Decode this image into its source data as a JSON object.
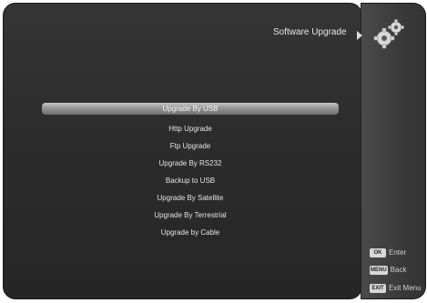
{
  "header": {
    "title": "Software Upgrade",
    "icon": "gear-icon"
  },
  "menu": {
    "items": [
      {
        "label": "Upgrade By USB",
        "selected": true
      },
      {
        "label": "Http Upgrade",
        "selected": false
      },
      {
        "label": "Ftp Upgrade",
        "selected": false
      },
      {
        "label": "Upgrade By RS232",
        "selected": false
      },
      {
        "label": "Backup to USB",
        "selected": false
      },
      {
        "label": "Upgrade By Satellite",
        "selected": false
      },
      {
        "label": "Upgrade By Terrestrial",
        "selected": false
      },
      {
        "label": "Upgrade by Cable",
        "selected": false
      }
    ]
  },
  "hints": {
    "enter": {
      "key": "OK",
      "label": "Enter"
    },
    "back": {
      "key": "MENU",
      "label": "Back"
    },
    "exit": {
      "key": "EXIT",
      "label": "Exit Menu"
    }
  },
  "colors": {
    "panel": "#2c2c2c",
    "side_panel": "#3a3a3a",
    "highlight": "#9a9a9a",
    "text": "#e2e2e2"
  }
}
